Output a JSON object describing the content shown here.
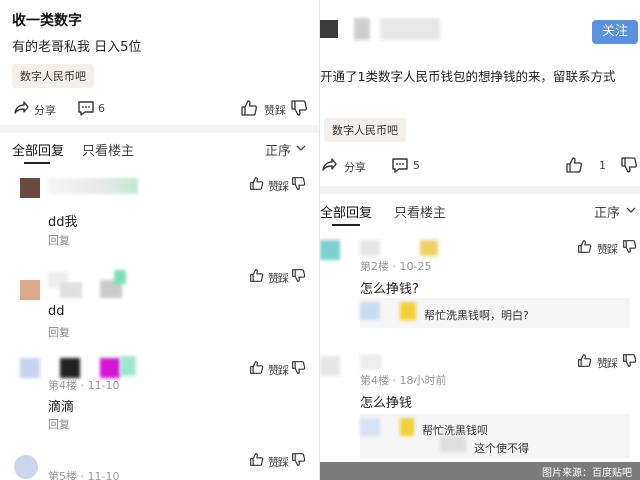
{
  "left": {
    "post_title": "收一类数字",
    "post_body": "有的老哥私我 日入5位",
    "tag": "数字人民币吧",
    "actions": {
      "share": "分享",
      "comments": "6",
      "like": "赞",
      "dislike": "踩"
    },
    "tabs": {
      "all": "全部回复",
      "op_only": "只看楼主",
      "order": "正序"
    },
    "replies": [
      {
        "content": "dd我",
        "reply": "回复",
        "like": "赞",
        "dislike": "踩"
      },
      {
        "content": "dd",
        "reply": "回复",
        "like": "赞",
        "dislike": "踩"
      },
      {
        "meta": "第4楼 · 11-10",
        "content": "滴滴",
        "reply": "回复",
        "like": "赞",
        "dislike": "踩"
      },
      {
        "meta": "第5楼 · 11-10",
        "like": "赞",
        "dislike": "踩"
      }
    ]
  },
  "right": {
    "follow": "关注",
    "post_body": "开通了1类数字人民币钱包的想挣钱的来，留联系方式",
    "tag": "数字人民币吧",
    "actions": {
      "share": "分享",
      "comments": "5",
      "likes": "1"
    },
    "tabs": {
      "all": "全部回复",
      "op_only": "只看楼主",
      "order": "正序"
    },
    "replies": [
      {
        "meta": "第2楼 · 10-25",
        "content": "怎么挣钱?",
        "subreply": "帮忙洗黑钱啊，明白?",
        "like": "赞",
        "dislike": "踩"
      },
      {
        "meta": "第4楼 · 18小时前",
        "content": "怎么挣钱",
        "subreply_1": "帮忙洗黑钱呗",
        "subreply_2": "这个使不得",
        "like": "赞",
        "dislike": "踩"
      }
    ]
  },
  "watermark": "图片来源：百度贴吧"
}
